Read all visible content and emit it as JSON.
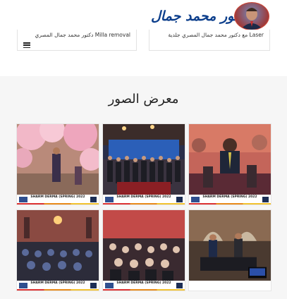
{
  "header": {
    "logo_text": "دكتور محمد جمال"
  },
  "cards": [
    {
      "title": "Milla removal دكتور محمد جمال المصري"
    },
    {
      "title": "Laser مع دكتور محمد جمال المصري جلدية"
    }
  ],
  "gallery": {
    "title": "معرض الصور",
    "photos": [
      {
        "caption": "SHARM DERMA (SPRING) 2022"
      },
      {
        "caption": "SHARM DERMA (SPRING) 2022"
      },
      {
        "caption": "SHARM DERMA (SPRING) 2022"
      },
      {
        "caption": "SHARM DERMA (SPRING) 2022"
      },
      {
        "caption": "SHARM DERMA (SPRING) 2022"
      },
      {
        "caption": "SHARM DERMA (SPRING) 2022"
      }
    ]
  },
  "colors": {
    "logo_blue": "#0d3f8c",
    "gallery_bg": "#f6f6f6"
  },
  "icons": [
    "menu-icon"
  ]
}
